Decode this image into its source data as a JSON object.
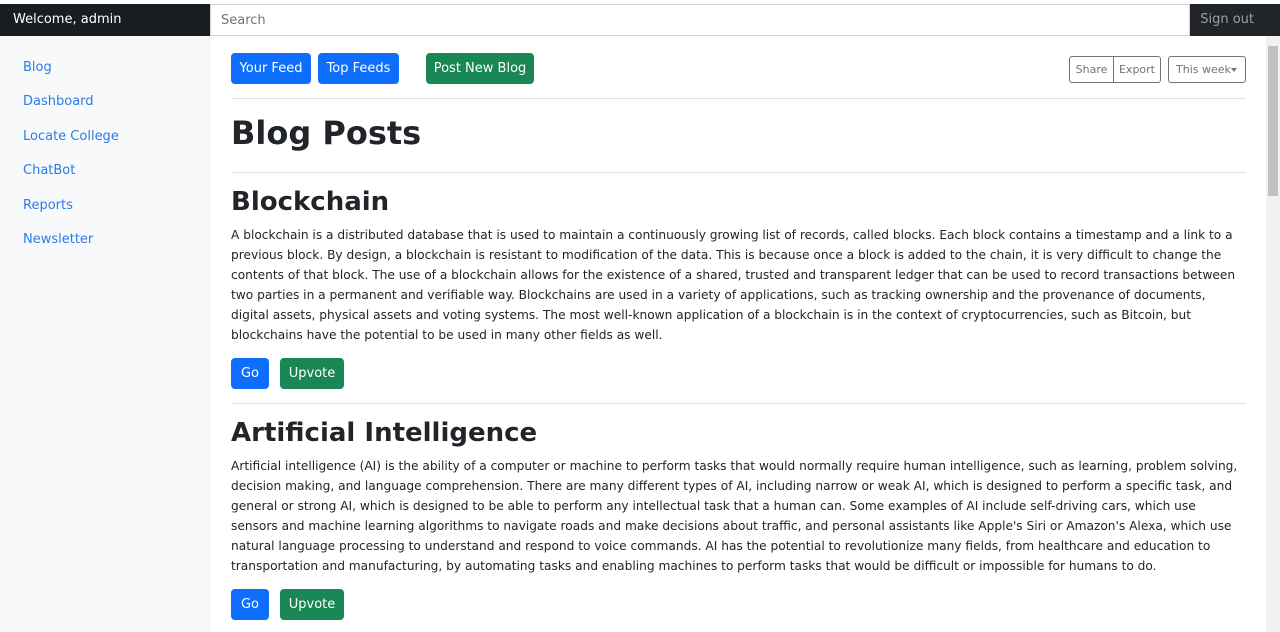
{
  "header": {
    "welcome": "Welcome, admin",
    "search_placeholder": "Search",
    "signout": "Sign out"
  },
  "sidebar": {
    "items": [
      {
        "label": "Blog"
      },
      {
        "label": "Dashboard"
      },
      {
        "label": "Locate College"
      },
      {
        "label": "ChatBot"
      },
      {
        "label": "Reports"
      },
      {
        "label": "Newsletter"
      }
    ]
  },
  "toolbar": {
    "your_feed": "Your Feed",
    "top_feeds": "Top Feeds",
    "post_new": "Post New Blog",
    "share": "Share",
    "export": "Export",
    "range": "This week"
  },
  "page_title": "Blog Posts",
  "posts": [
    {
      "title": "Blockchain",
      "body": "A blockchain is a distributed database that is used to maintain a continuously growing list of records, called blocks. Each block contains a timestamp and a link to a previous block. By design, a blockchain is resistant to modification of the data. This is because once a block is added to the chain, it is very difficult to change the contents of that block. The use of a blockchain allows for the existence of a shared, trusted and transparent ledger that can be used to record transactions between two parties in a permanent and verifiable way. Blockchains are used in a variety of applications, such as tracking ownership and the provenance of documents, digital assets, physical assets and voting systems. The most well-known application of a blockchain is in the context of cryptocurrencies, such as Bitcoin, but blockchains have the potential to be used in many other fields as well.",
      "go": "Go",
      "upvote": "Upvote"
    },
    {
      "title": "Artificial Intelligence",
      "body": "Artificial intelligence (AI) is the ability of a computer or machine to perform tasks that would normally require human intelligence, such as learning, problem solving, decision making, and language comprehension. There are many different types of AI, including narrow or weak AI, which is designed to perform a specific task, and general or strong AI, which is designed to be able to perform any intellectual task that a human can. Some examples of AI include self-driving cars, which use sensors and machine learning algorithms to navigate roads and make decisions about traffic, and personal assistants like Apple's Siri or Amazon's Alexa, which use natural language processing to understand and respond to voice commands. AI has the potential to revolutionize many fields, from healthcare and education to transportation and manufacturing, by automating tasks and enabling machines to perform tasks that would be difficult or impossible for humans to do.",
      "go": "Go",
      "upvote": "Upvote"
    }
  ]
}
